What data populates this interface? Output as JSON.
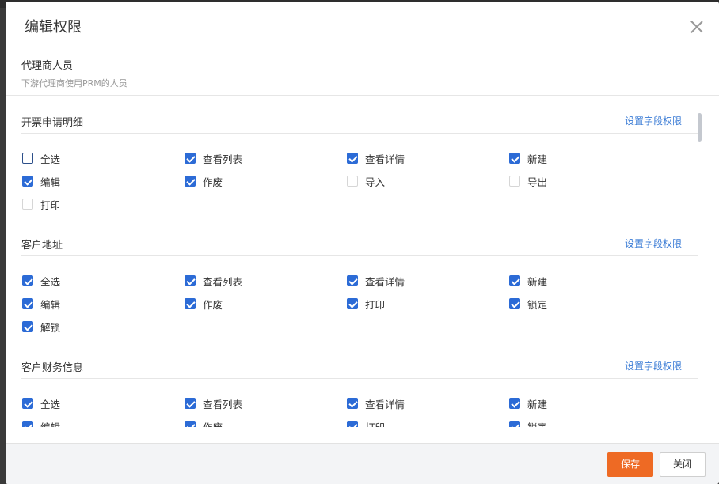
{
  "dialog": {
    "title": "编辑权限",
    "close_icon": "close-icon"
  },
  "role": {
    "name": "代理商人员",
    "description": "下游代理商使用PRM的人员"
  },
  "sections": [
    {
      "title": "开票申请明细",
      "link": "设置字段权限",
      "perms": [
        {
          "label": "全选",
          "checked": false,
          "style": "strong"
        },
        {
          "label": "查看列表",
          "checked": true
        },
        {
          "label": "查看详情",
          "checked": true
        },
        {
          "label": "新建",
          "checked": true
        },
        {
          "label": "编辑",
          "checked": true
        },
        {
          "label": "作废",
          "checked": true
        },
        {
          "label": "导入",
          "checked": false,
          "style": "light"
        },
        {
          "label": "导出",
          "checked": false,
          "style": "light"
        },
        {
          "label": "打印",
          "checked": false,
          "style": "light"
        }
      ]
    },
    {
      "title": "客户地址",
      "link": "设置字段权限",
      "perms": [
        {
          "label": "全选",
          "checked": true
        },
        {
          "label": "查看列表",
          "checked": true
        },
        {
          "label": "查看详情",
          "checked": true
        },
        {
          "label": "新建",
          "checked": true
        },
        {
          "label": "编辑",
          "checked": true
        },
        {
          "label": "作废",
          "checked": true
        },
        {
          "label": "打印",
          "checked": true
        },
        {
          "label": "锁定",
          "checked": true
        },
        {
          "label": "解锁",
          "checked": true
        }
      ]
    },
    {
      "title": "客户财务信息",
      "link": "设置字段权限",
      "perms": [
        {
          "label": "全选",
          "checked": true
        },
        {
          "label": "查看列表",
          "checked": true
        },
        {
          "label": "查看详情",
          "checked": true
        },
        {
          "label": "新建",
          "checked": true
        },
        {
          "label": "编辑",
          "checked": true
        },
        {
          "label": "作废",
          "checked": true
        },
        {
          "label": "打印",
          "checked": true
        },
        {
          "label": "锁定",
          "checked": true
        }
      ]
    }
  ],
  "footer": {
    "save_label": "保存",
    "close_label": "关闭"
  },
  "colors": {
    "accent": "#2c6bd6",
    "primary_button": "#ee6a24",
    "link": "#3a7bd5"
  }
}
